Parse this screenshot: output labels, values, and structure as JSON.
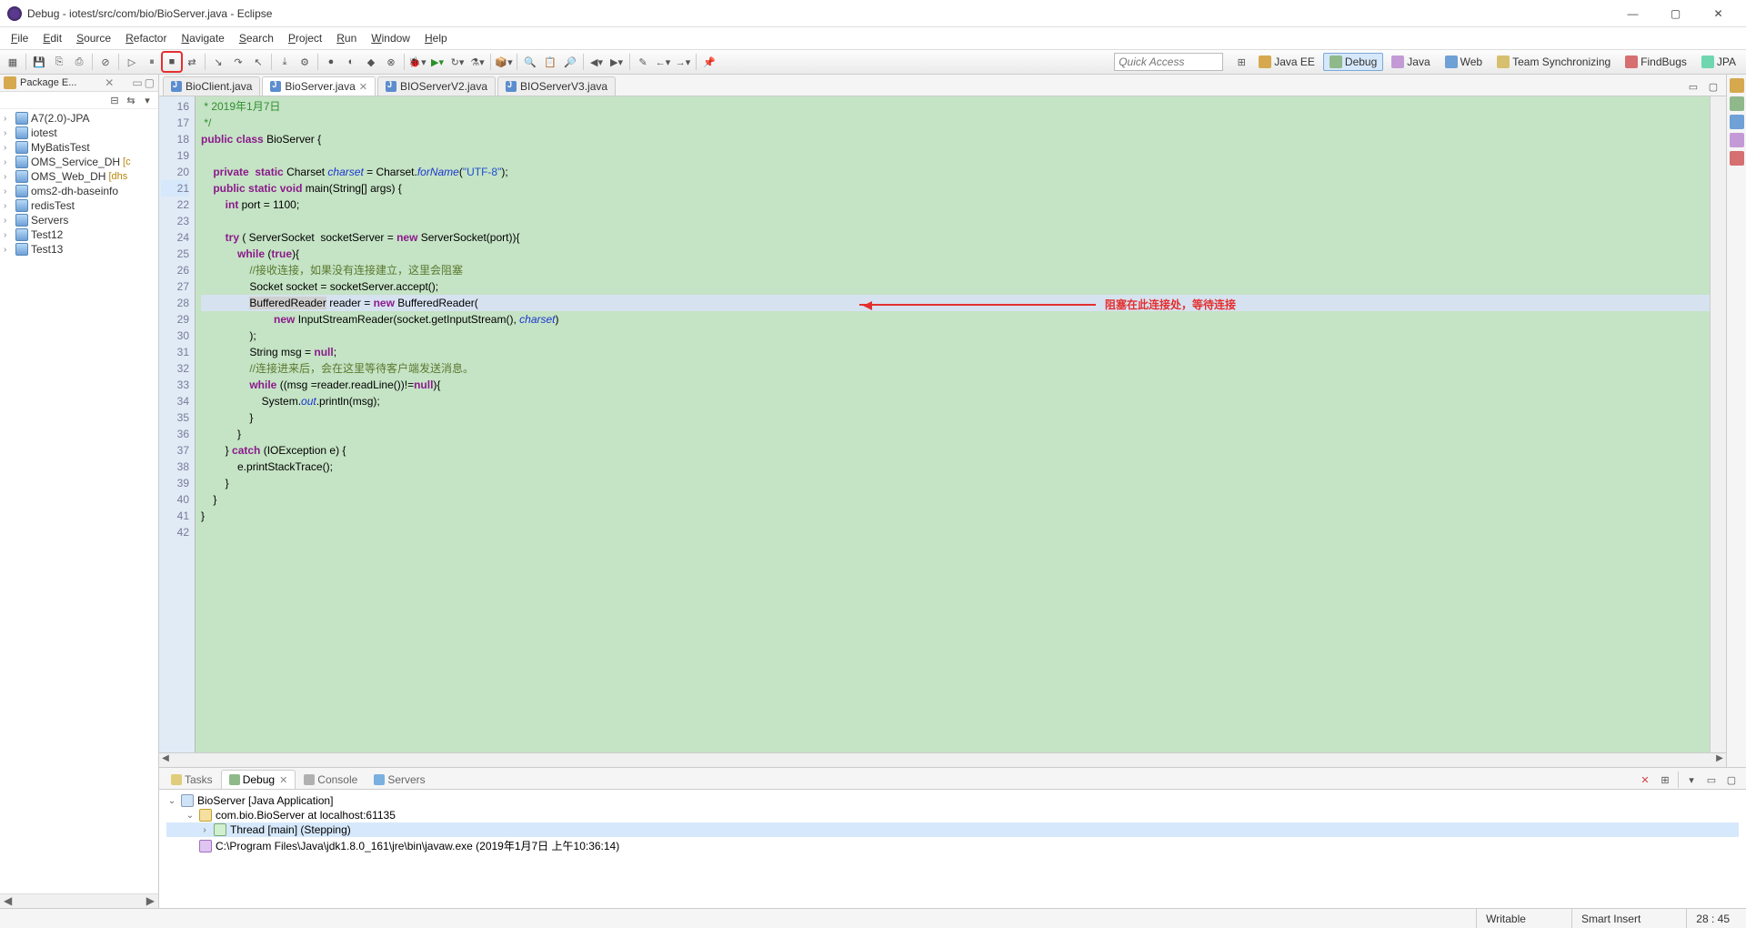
{
  "title": "Debug - iotest/src/com/bio/BioServer.java - Eclipse",
  "menus": [
    "File",
    "Edit",
    "Source",
    "Refactor",
    "Navigate",
    "Search",
    "Project",
    "Run",
    "Window",
    "Help"
  ],
  "quick_access_placeholder": "Quick Access",
  "perspectives": [
    {
      "label": "Java EE",
      "cls": "jee"
    },
    {
      "label": "Debug",
      "cls": "debug",
      "active": true
    },
    {
      "label": "Java",
      "cls": "java"
    },
    {
      "label": "Web",
      "cls": "web"
    },
    {
      "label": "Team Synchronizing",
      "cls": "team"
    },
    {
      "label": "FindBugs",
      "cls": "findbugs"
    },
    {
      "label": "JPA",
      "cls": "jpa"
    }
  ],
  "package_explorer": {
    "title": "Package E...",
    "projects": [
      {
        "label": "A7(2.0)-JPA"
      },
      {
        "label": "iotest"
      },
      {
        "label": "MyBatisTest"
      },
      {
        "label": "OMS_Service_DH",
        "decor": "[c"
      },
      {
        "label": "OMS_Web_DH",
        "decor": "[dhs"
      },
      {
        "label": "oms2-dh-baseinfo"
      },
      {
        "label": "redisTest"
      },
      {
        "label": "Servers"
      },
      {
        "label": "Test12"
      },
      {
        "label": "Test13"
      }
    ]
  },
  "editor_tabs": [
    {
      "label": "BioClient.java"
    },
    {
      "label": "BioServer.java",
      "active": true
    },
    {
      "label": "BIOServerV2.java"
    },
    {
      "label": "BIOServerV3.java"
    }
  ],
  "code_start_line": 16,
  "annotation_text": "阻塞在此连接处，等待连接",
  "bottom_tabs": [
    {
      "label": "Tasks",
      "cls": "tasks"
    },
    {
      "label": "Debug",
      "cls": "debug",
      "active": true
    },
    {
      "label": "Console",
      "cls": "console"
    },
    {
      "label": "Servers",
      "cls": "servers"
    }
  ],
  "debug_tree": {
    "app": "BioServer [Java Application]",
    "vm": "com.bio.BioServer at localhost:61135",
    "thread": "Thread [main] (Stepping)",
    "proc": "C:\\Program Files\\Java\\jdk1.8.0_161\\jre\\bin\\javaw.exe (2019年1月7日 上午10:36:14)"
  },
  "status": {
    "writable": "Writable",
    "insert": "Smart Insert",
    "pos": "28 : 45"
  }
}
